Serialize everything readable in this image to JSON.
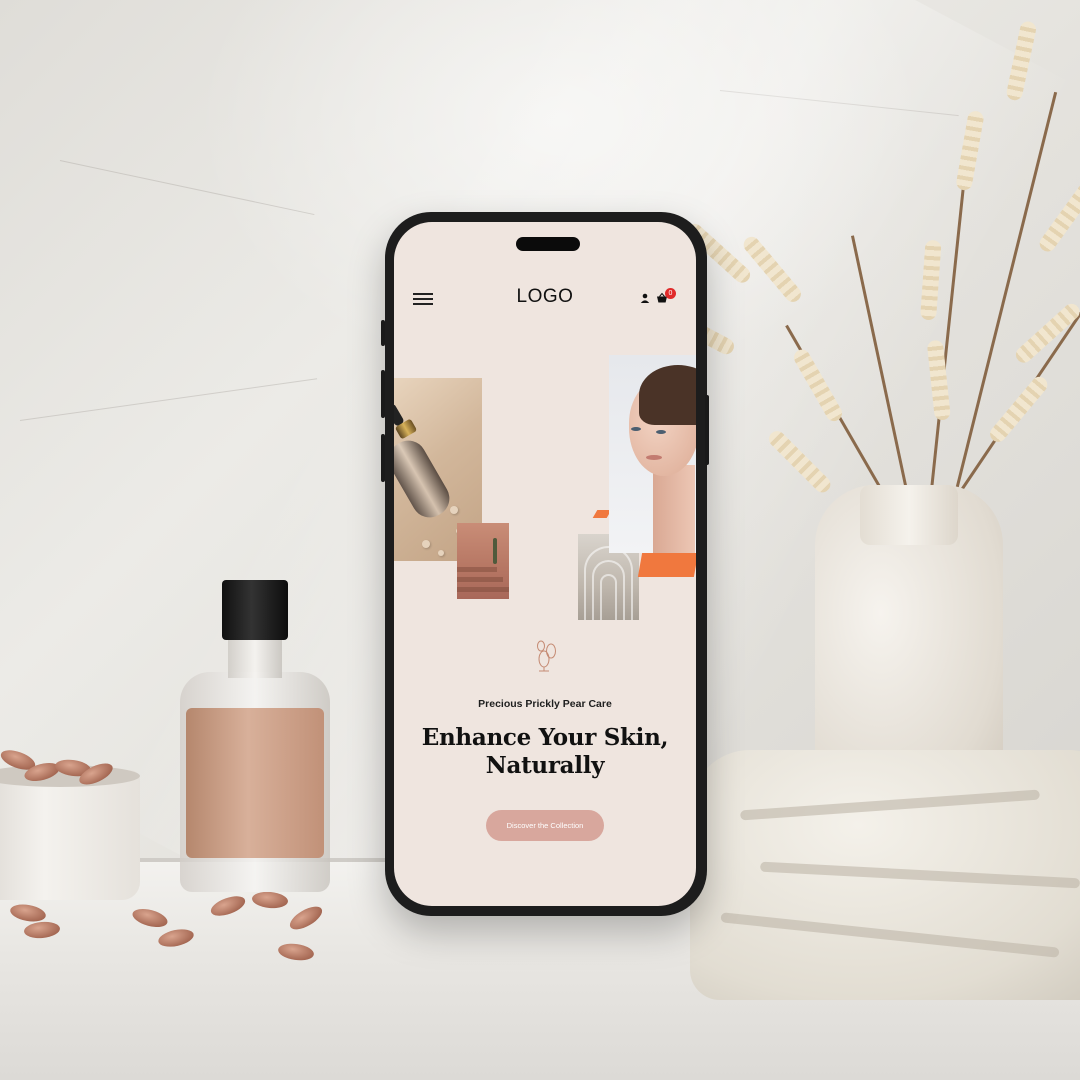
{
  "header": {
    "logo": "LOGO",
    "cart_count": "0",
    "icons": [
      "hamburger-menu-icon",
      "user-icon",
      "shopping-basket-icon"
    ]
  },
  "hero": {
    "subtitle": "Precious Prickly Pear Care",
    "headline_line1": "Enhance Your Skin,",
    "headline_line2": "Naturally",
    "cta_label": "Discover the Collection",
    "decor_icon": "prickly-pear-cactus-icon"
  },
  "colors": {
    "screen_bg": "#efe5df",
    "cta_bg": "#d8a79d",
    "accent_orange": "#f0783e",
    "badge": "#e02a2a"
  }
}
